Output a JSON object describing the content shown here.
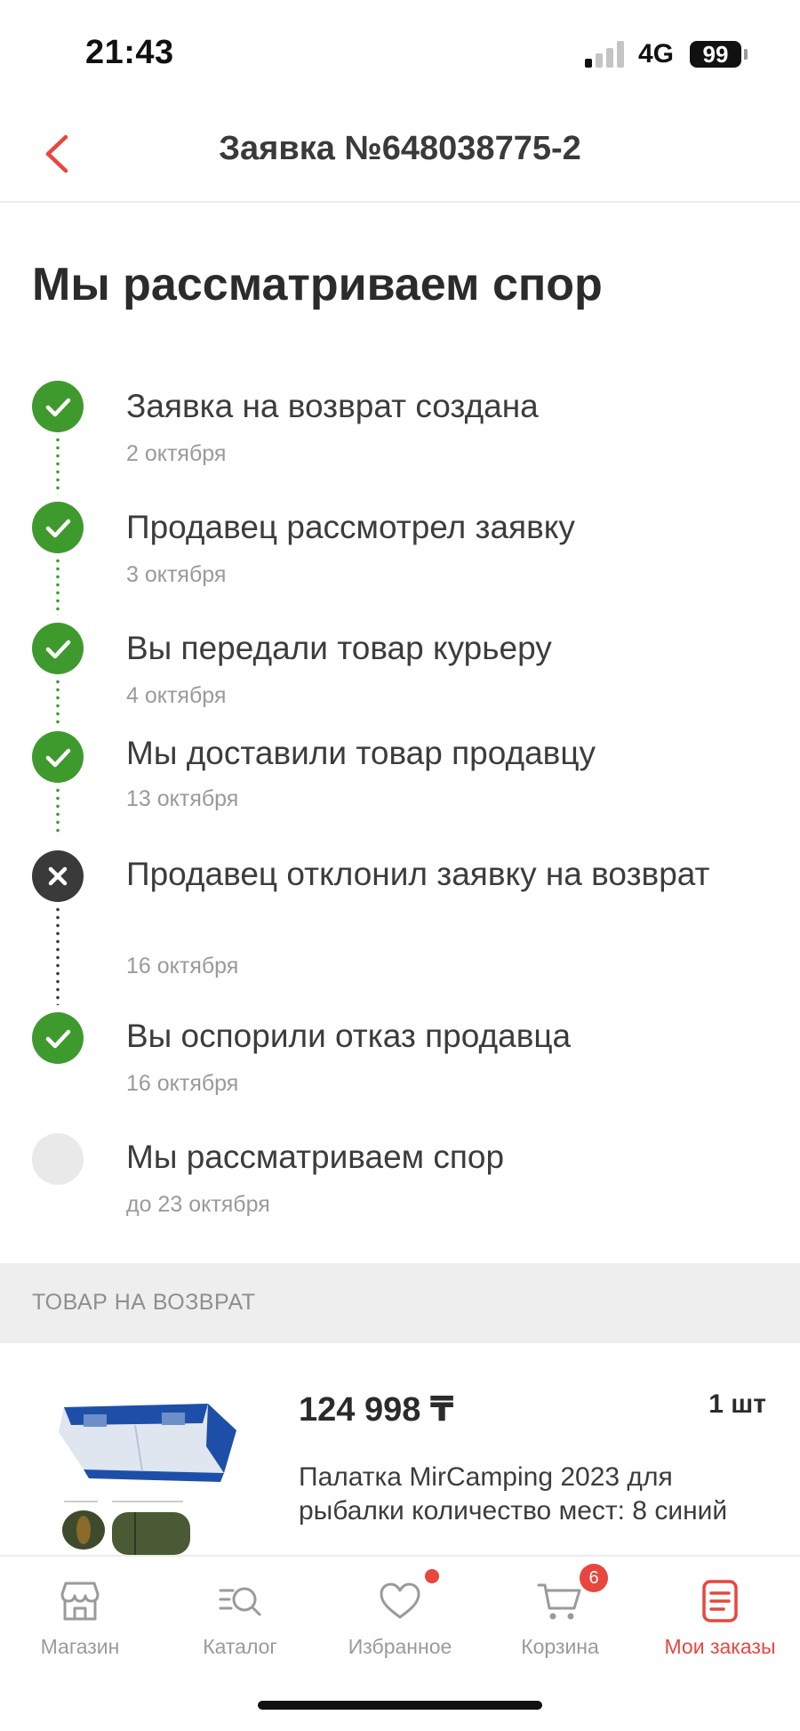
{
  "status_bar": {
    "time": "21:43",
    "network": "4G",
    "battery": "99"
  },
  "header": {
    "title": "Заявка №648038775-2",
    "back_icon": "chevron-left-icon"
  },
  "main": {
    "heading": "Мы рассматриваем спор"
  },
  "timeline": [
    {
      "title": "Заявка на возврат создана",
      "date": "2 октября",
      "state": "done"
    },
    {
      "title": "Продавец рассмотрел заявку",
      "date": "3 октября",
      "state": "done"
    },
    {
      "title": "Вы передали товар курьеру",
      "date": "4 октября",
      "state": "done"
    },
    {
      "title": "Мы доставили товар продавцу",
      "date": "13 октября",
      "state": "done"
    },
    {
      "title": "Продавец отклонил заявку на возврат",
      "date": "16 октября",
      "state": "rejected"
    },
    {
      "title": "Вы оспорили отказ продавца",
      "date": "16 октября",
      "state": "done"
    },
    {
      "title": "Мы рассматриваем спор",
      "date": "до 23 октября",
      "state": "pending"
    }
  ],
  "return_section": {
    "label": "ТОВАР НА ВОЗВРАТ"
  },
  "product": {
    "price": "124 998 ₸",
    "quantity": "1 шт",
    "name": "Палатка MirCamping 2023 для рыбалки количество мест: 8 синий"
  },
  "bottom_nav": {
    "items": [
      {
        "label": "Магазин",
        "icon": "store-icon"
      },
      {
        "label": "Каталог",
        "icon": "catalog-search-icon"
      },
      {
        "label": "Избранное",
        "icon": "heart-icon",
        "dot": true
      },
      {
        "label": "Корзина",
        "icon": "cart-icon",
        "badge": "6"
      },
      {
        "label": "Мои заказы",
        "icon": "orders-icon",
        "active": true
      }
    ]
  },
  "colors": {
    "accent": "#e8463f",
    "success": "#3f9a2e",
    "rejected": "#3a3a3a",
    "pending": "#e9e9e9"
  }
}
